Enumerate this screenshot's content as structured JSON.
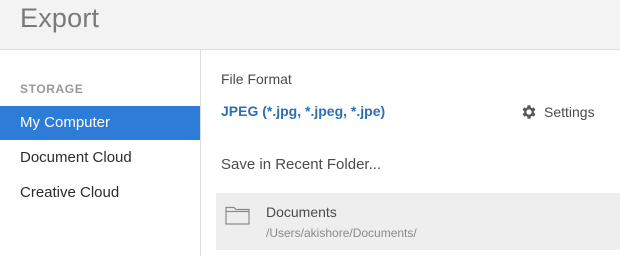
{
  "header": {
    "title": "Export"
  },
  "sidebar": {
    "heading": "STORAGE",
    "items": [
      {
        "label": "My Computer",
        "selected": true
      },
      {
        "label": "Document Cloud",
        "selected": false
      },
      {
        "label": "Creative Cloud",
        "selected": false
      }
    ]
  },
  "main": {
    "file_format_label": "File Format",
    "file_format_value": "JPEG (*.jpg, *.jpeg, *.jpe)",
    "settings_label": "Settings",
    "settings_icon": "gear-icon",
    "recent_folder_label": "Save in Recent Folder...",
    "recent_folders": [
      {
        "name": "Documents",
        "path": "/Users/akishore/Documents/",
        "icon": "folder-icon"
      }
    ]
  },
  "colors": {
    "accent": "#2d7cd7",
    "link": "#2d6fb5",
    "title": "#7a7a7a"
  }
}
